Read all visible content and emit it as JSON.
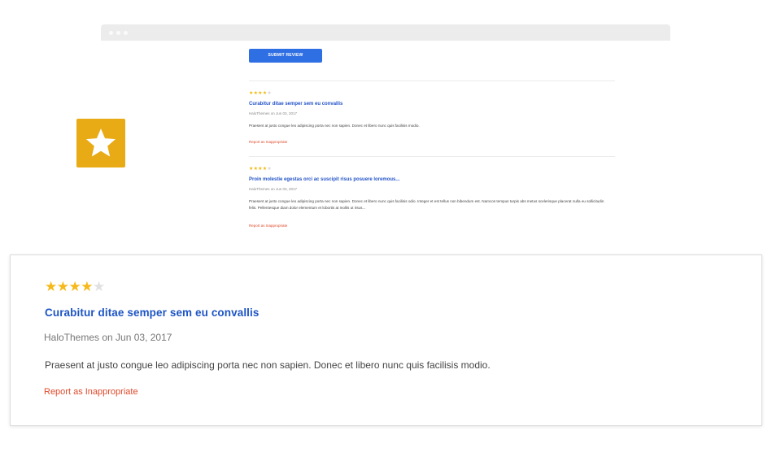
{
  "preview": {
    "submit_label": "SUBMIT REVIEW",
    "reviews": [
      {
        "rating": 4,
        "max_rating": 5,
        "title": "Curabitur ditae semper sem eu convallis",
        "author": "HaloThemes on Jun 03, 2017",
        "body": "Praesent at justo congue leo adipiscing porta nec non sapien. Donec et libero nunc quis facilisis modio.",
        "report": "Report as Inappropriate"
      },
      {
        "rating": 4,
        "max_rating": 5,
        "title": "Proin molestie egestas orci ac suscipit risus posuere loremous...",
        "author": "HaloThemes on Jun 03, 2017",
        "body": "Praesent at justo congue leo adipiscing porta nec non sapien. Donec et libero nunc quis facilisis odio. Integer et est tellus non bibendum est. Namcos tempus turpis abs metus scelerisque placerat nulla eu sollicitudin felis. Pellentesque diam dolor elementum et lobortis at mollis ut risus...",
        "report": "Report as Inappropriate"
      }
    ]
  },
  "badge": {
    "icon": "star-icon",
    "color": "#e8ab15"
  },
  "highlight": {
    "rating": 4,
    "max_rating": 5,
    "title": "Curabitur ditae semper sem eu convallis",
    "author": "HaloThemes on Jun 03, 2017",
    "body": "Praesent at justo congue leo adipiscing porta nec non sapien. Donec et libero nunc quis facilisis modio.",
    "report": "Report as Inappropriate"
  }
}
